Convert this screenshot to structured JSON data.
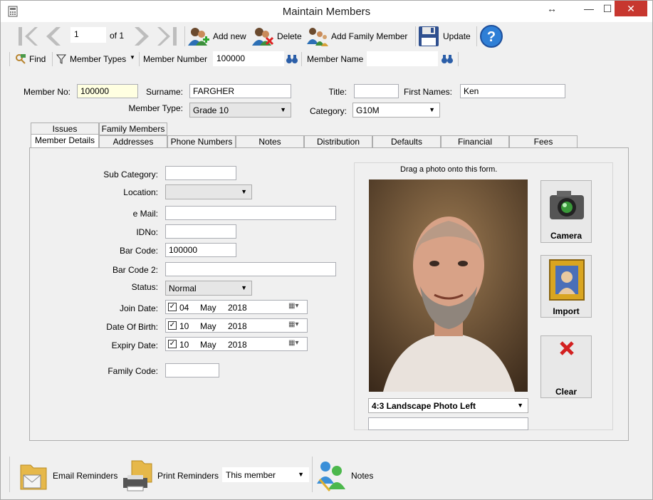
{
  "window": {
    "title": "Maintain Members",
    "resize_glyph": "↔",
    "min_glyph": "—",
    "max_glyph": "☐",
    "close_glyph": "✕"
  },
  "nav": {
    "page_value": "1",
    "of_label": "of 1"
  },
  "toolbar": {
    "add_new": "Add new",
    "delete": "Delete",
    "add_family": "Add Family Member",
    "update": "Update"
  },
  "findbar": {
    "find": "Find",
    "member_types": "Member Types",
    "member_number_label": "Member Number",
    "member_number_value": "100000",
    "member_name_label": "Member Name",
    "member_name_value": ""
  },
  "header": {
    "member_no_label": "Member No:",
    "member_no": "100000",
    "surname_label": "Surname:",
    "surname": "FARGHER",
    "title_label": "Title:",
    "title": "",
    "first_names_label": "First Names:",
    "first_names": "Ken",
    "member_type_label": "Member Type:",
    "member_type": "Grade 10",
    "category_label": "Category:",
    "category": "G10M"
  },
  "tabs_row1": [
    "Issues",
    "Family Members"
  ],
  "tabs_row2": [
    "Member Details",
    "Addresses",
    "Phone Numbers",
    "Notes",
    "Distribution",
    "Defaults",
    "Financial",
    "Fees"
  ],
  "details": {
    "sub_category_label": "Sub Category:",
    "sub_category": "",
    "location_label": "Location:",
    "location": "",
    "email_label": "e Mail:",
    "email": "",
    "idno_label": "IDNo:",
    "idno": "",
    "barcode_label": "Bar Code:",
    "barcode": "100000",
    "barcode2_label": "Bar Code 2:",
    "barcode2": "",
    "status_label": "Status:",
    "status": "Normal",
    "join_label": "Join Date:",
    "join": {
      "day": "04",
      "month": "May",
      "year": "2018"
    },
    "dob_label": "Date Of Birth:",
    "dob": {
      "day": "10",
      "month": "May",
      "year": "2018"
    },
    "expiry_label": "Expiry Date:",
    "expiry": {
      "day": "10",
      "month": "May",
      "year": "2018"
    },
    "family_code_label": "Family Code:",
    "family_code": ""
  },
  "photo": {
    "hint": "Drag a photo onto this form.",
    "layout": "4:3 Landscape Photo Left",
    "caption": "",
    "camera": "Camera",
    "import": "Import",
    "clear": "Clear"
  },
  "bottom": {
    "email_reminders": "Email Reminders",
    "print_reminders": "Print Reminders",
    "scope": "This member",
    "notes": "Notes"
  }
}
